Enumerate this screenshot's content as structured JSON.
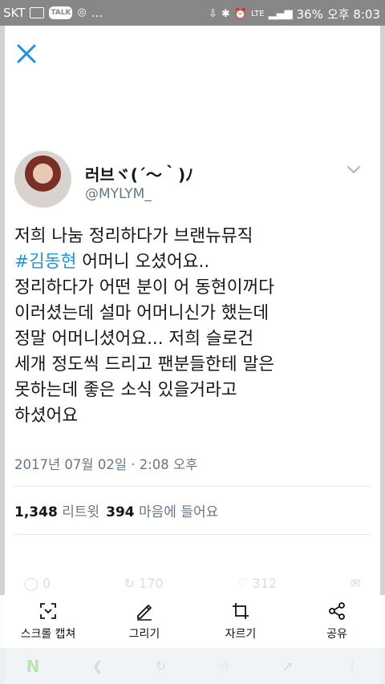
{
  "status_bar": {
    "carrier": "SKT",
    "talk_badge": "TALK",
    "more": "...",
    "lte": "LTE",
    "battery": "36%",
    "time": "오후 8:03"
  },
  "tweet": {
    "display_name": "러브ヾ(´〜｀)ﾉ",
    "handle": "@MYLYM_",
    "lines": {
      "l1": "저희 나눔 정리하다가 브랜뉴뮤직",
      "l2_hashtag": "#김동현",
      "l2_rest": " 어머니 오셨어요..",
      "l3": "정리하다가 어떤 분이 어 동현이꺼다",
      "l4": "이러셨는데 설마 어머니신가 했는데",
      "l5": "정말 어머니셨어요... 저희 슬로건",
      "l6": "세개 정도씩 드리고 팬분들한테 말은",
      "l7": "못하는데 좋은 소식 있을거라고",
      "l8": "하셨어요"
    },
    "timestamp": "2017년 07월 02일 · 2:08 오후",
    "retweet_count": "1,348",
    "retweet_label": "리트윗",
    "like_count": "394",
    "like_label": "마음에 들어요"
  },
  "ghost_actions": {
    "reply": "0",
    "retweet": "170",
    "like": "312"
  },
  "capture_bar": {
    "scroll_capture": "스크롤 캡쳐",
    "draw": "그리기",
    "crop": "자르기",
    "share": "공유"
  },
  "colors": {
    "accent": "#1b95e0",
    "text": "#14171a",
    "muted": "#657786"
  }
}
